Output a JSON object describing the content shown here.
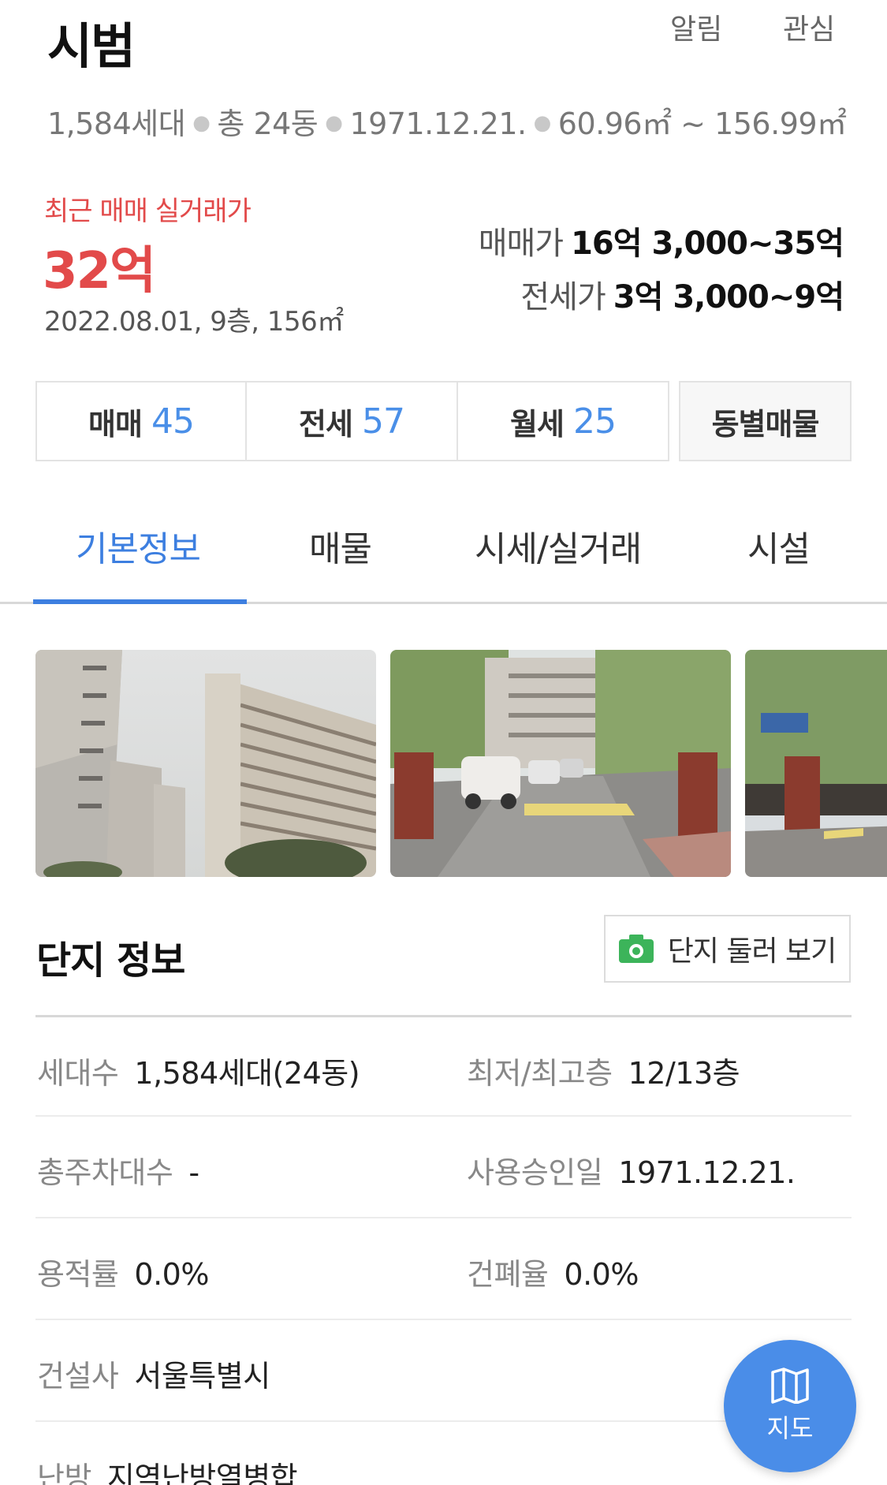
{
  "header": {
    "title": "시범",
    "alarm_label": "알림",
    "favorite_label": "관심"
  },
  "summary": {
    "households": "1,584세대",
    "buildings": "총 24동",
    "approval_date": "1971.12.21.",
    "area_range": "60.96㎡ ~ 156.99㎡"
  },
  "recent_trade": {
    "label": "최근 매매 실거래가",
    "price": "32억",
    "detail": "2022.08.01, 9층, 156㎡"
  },
  "prices": {
    "sale_label": "매매가",
    "sale_value": "16억 3,000~35억",
    "jeonse_label": "전세가",
    "jeonse_value": "3억 3,000~9억"
  },
  "listing_counts": [
    {
      "label": "매매",
      "count": "45"
    },
    {
      "label": "전세",
      "count": "57"
    },
    {
      "label": "월세",
      "count": "25"
    }
  ],
  "by_building_label": "동별매물",
  "tabs": [
    {
      "label": "기본정보",
      "active": true
    },
    {
      "label": "매물",
      "active": false
    },
    {
      "label": "시세/실거래",
      "active": false
    },
    {
      "label": "시설",
      "active": false
    }
  ],
  "section": {
    "title": "단지 정보",
    "tour_button": "단지 둘러 보기"
  },
  "info_rows": [
    {
      "left_label": "세대수",
      "left_value": "1,584세대(24동)",
      "right_label": "최저/최고층",
      "right_value": "12/13층"
    },
    {
      "left_label": "총주차대수",
      "left_value": "-",
      "right_label": "사용승인일",
      "right_value": "1971.12.21."
    },
    {
      "left_label": "용적률",
      "left_value": "0.0%",
      "right_label": "건폐율",
      "right_value": "0.0%"
    },
    {
      "left_label": "건설사",
      "left_value": "서울특별시",
      "right_label": "",
      "right_value": ""
    },
    {
      "left_label": "난방",
      "left_value": "지역난방열병합",
      "right_label": "",
      "right_value": ""
    }
  ],
  "map_button": {
    "label": "지도",
    "icon": "map-icon"
  },
  "colors": {
    "accent_blue": "#3d7fe0",
    "price_red": "#e24a4a",
    "fab_blue": "#4a8de8",
    "camera_green": "#3cb45a"
  }
}
